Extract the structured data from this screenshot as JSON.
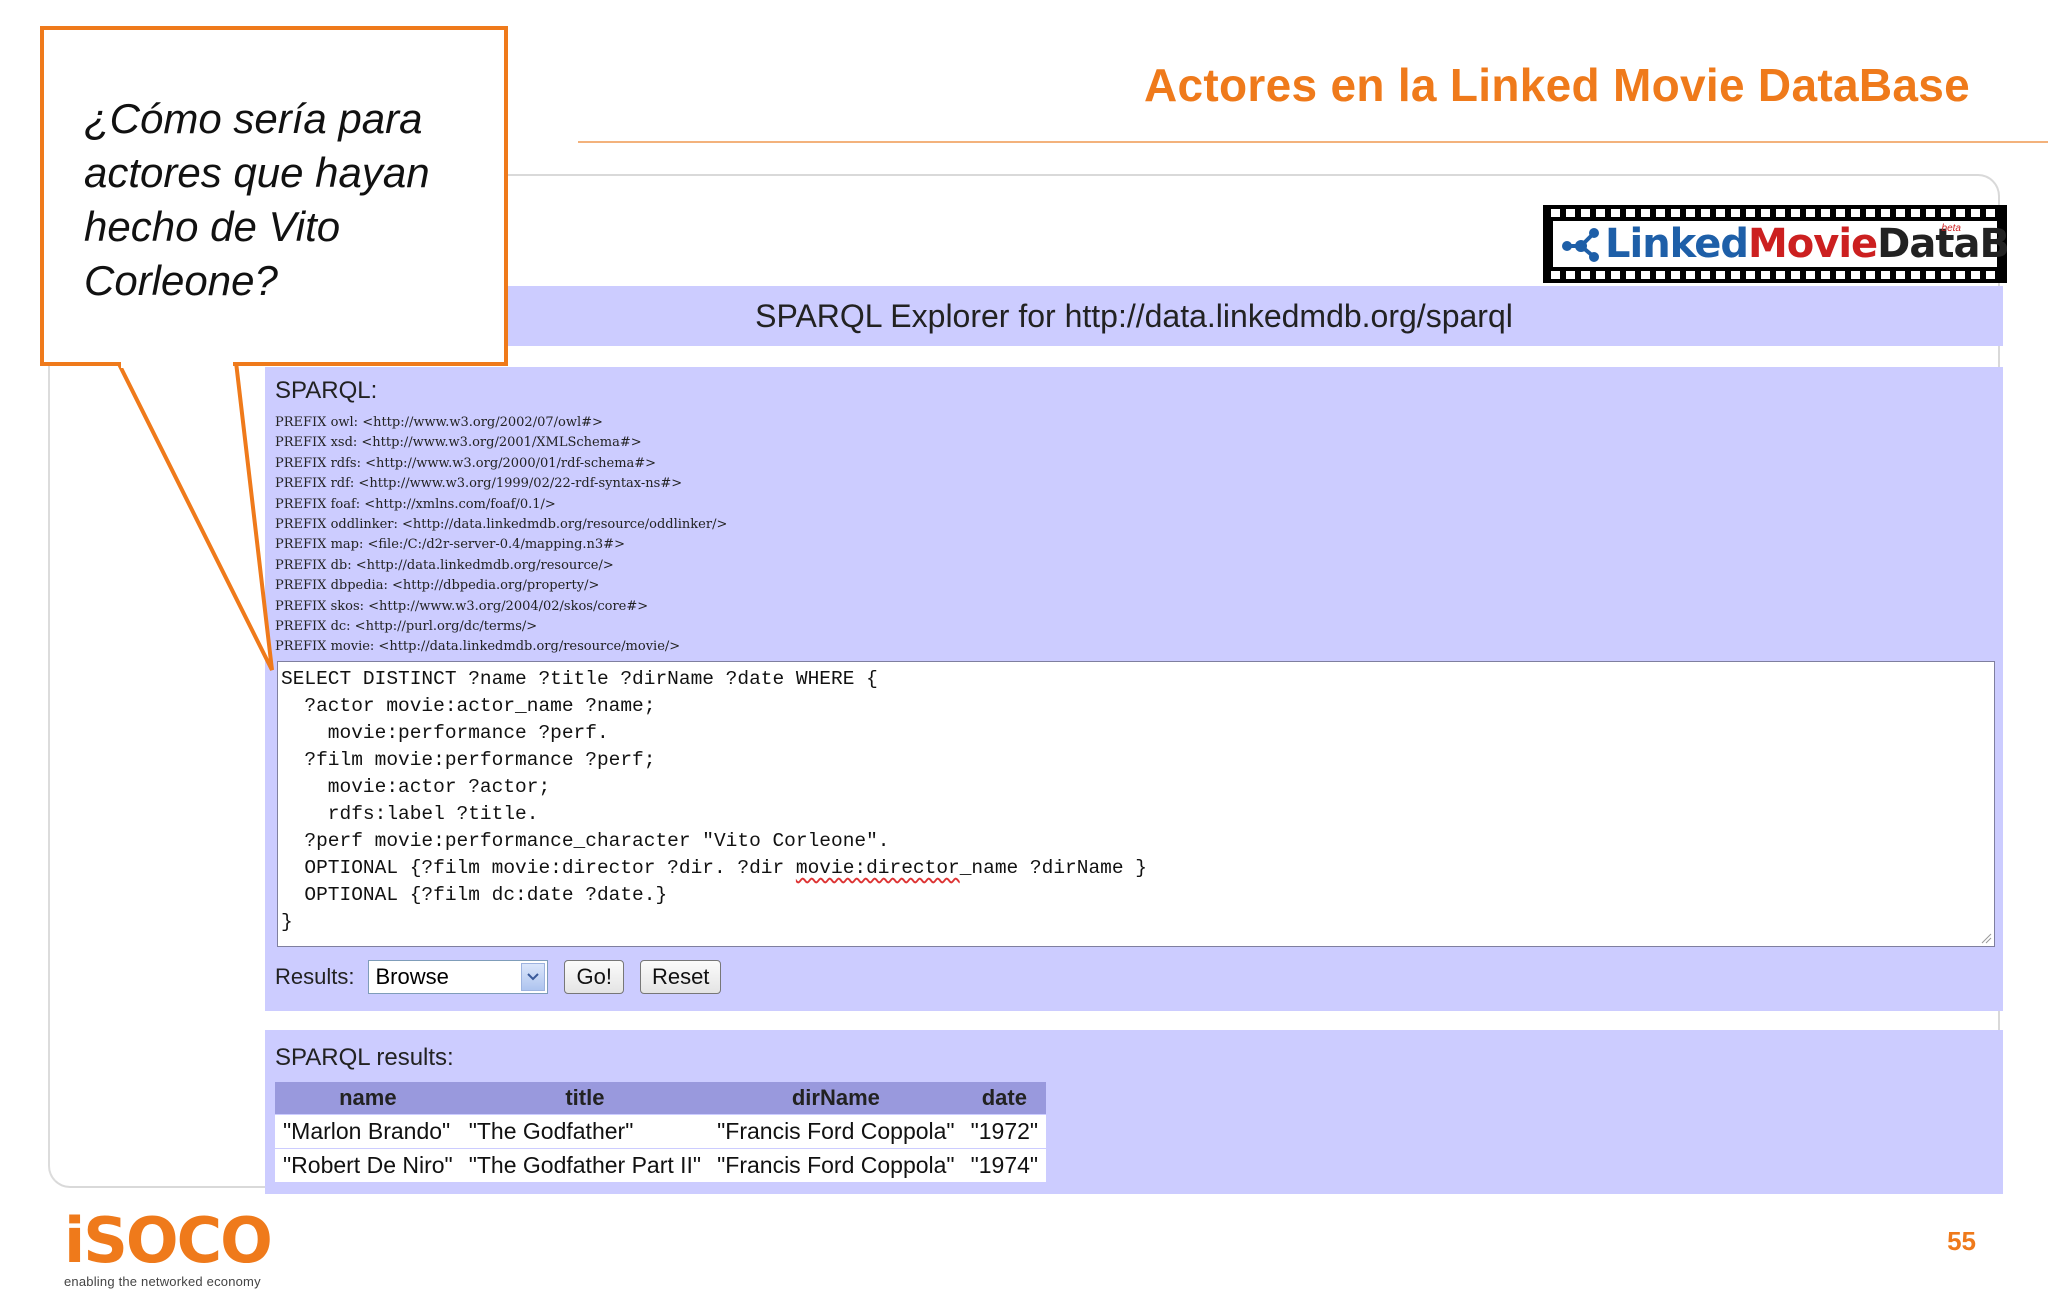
{
  "slide": {
    "title": "Actores en la Linked Movie DataBase",
    "page_number": "55",
    "accent_color": "#ef7a1b"
  },
  "callout": {
    "text": "¿Cómo sería para actores que hayan hecho de Vito Corleone?"
  },
  "logo": {
    "linked": "Linked",
    "movie": "Movie",
    "database": "DataBase",
    "beta": "beta"
  },
  "explorer": {
    "header": "SPARQL Explorer for http://data.linkedmdb.org/sparql",
    "sparql_label": "SPARQL:",
    "prefixes": [
      "PREFIX owl: <http://www.w3.org/2002/07/owl#>",
      "PREFIX xsd: <http://www.w3.org/2001/XMLSchema#>",
      "PREFIX rdfs: <http://www.w3.org/2000/01/rdf-schema#>",
      "PREFIX rdf: <http://www.w3.org/1999/02/22-rdf-syntax-ns#>",
      "PREFIX foaf: <http://xmlns.com/foaf/0.1/>",
      "PREFIX oddlinker: <http://data.linkedmdb.org/resource/oddlinker/>",
      "PREFIX map: <file:/C:/d2r-server-0.4/mapping.n3#>",
      "PREFIX db: <http://data.linkedmdb.org/resource/>",
      "PREFIX dbpedia: <http://dbpedia.org/property/>",
      "PREFIX skos: <http://www.w3.org/2004/02/skos/core#>",
      "PREFIX dc: <http://purl.org/dc/terms/>",
      "PREFIX movie: <http://data.linkedmdb.org/resource/movie/>"
    ],
    "query": {
      "l1": "SELECT DISTINCT ?name ?title ?dirName ?date WHERE {",
      "l2": "  ?actor movie:actor_name ?name;",
      "l3": "    movie:performance ?perf.",
      "l4": "  ?film movie:performance ?perf;",
      "l5": "    movie:actor ?actor;",
      "l6": "    rdfs:label ?title.",
      "l7": "  ?perf movie:performance_character \"Vito Corleone\".",
      "l8a": "  OPTIONAL {?film movie:director ?dir. ?dir ",
      "l8b": "movie:director",
      "l8c": "_name ?dirName }",
      "l9": "  OPTIONAL {?film dc:date ?date.}",
      "l10": "}"
    },
    "results_label": "Results:",
    "results_select_value": "Browse",
    "go_button": "Go!",
    "reset_button": "Reset"
  },
  "results": {
    "label": "SPARQL results:",
    "columns": [
      "name",
      "title",
      "dirName",
      "date"
    ],
    "rows": [
      [
        "\"Marlon Brando\"",
        "\"The Godfather\"",
        "\"Francis Ford Coppola\"",
        "\"1972\""
      ],
      [
        "\"Robert De Niro\"",
        "\"The Godfather Part II\"",
        "\"Francis Ford Coppola\"",
        "\"1974\""
      ]
    ]
  },
  "footer": {
    "brand": "iSOCO",
    "tagline": "enabling the networked economy"
  }
}
